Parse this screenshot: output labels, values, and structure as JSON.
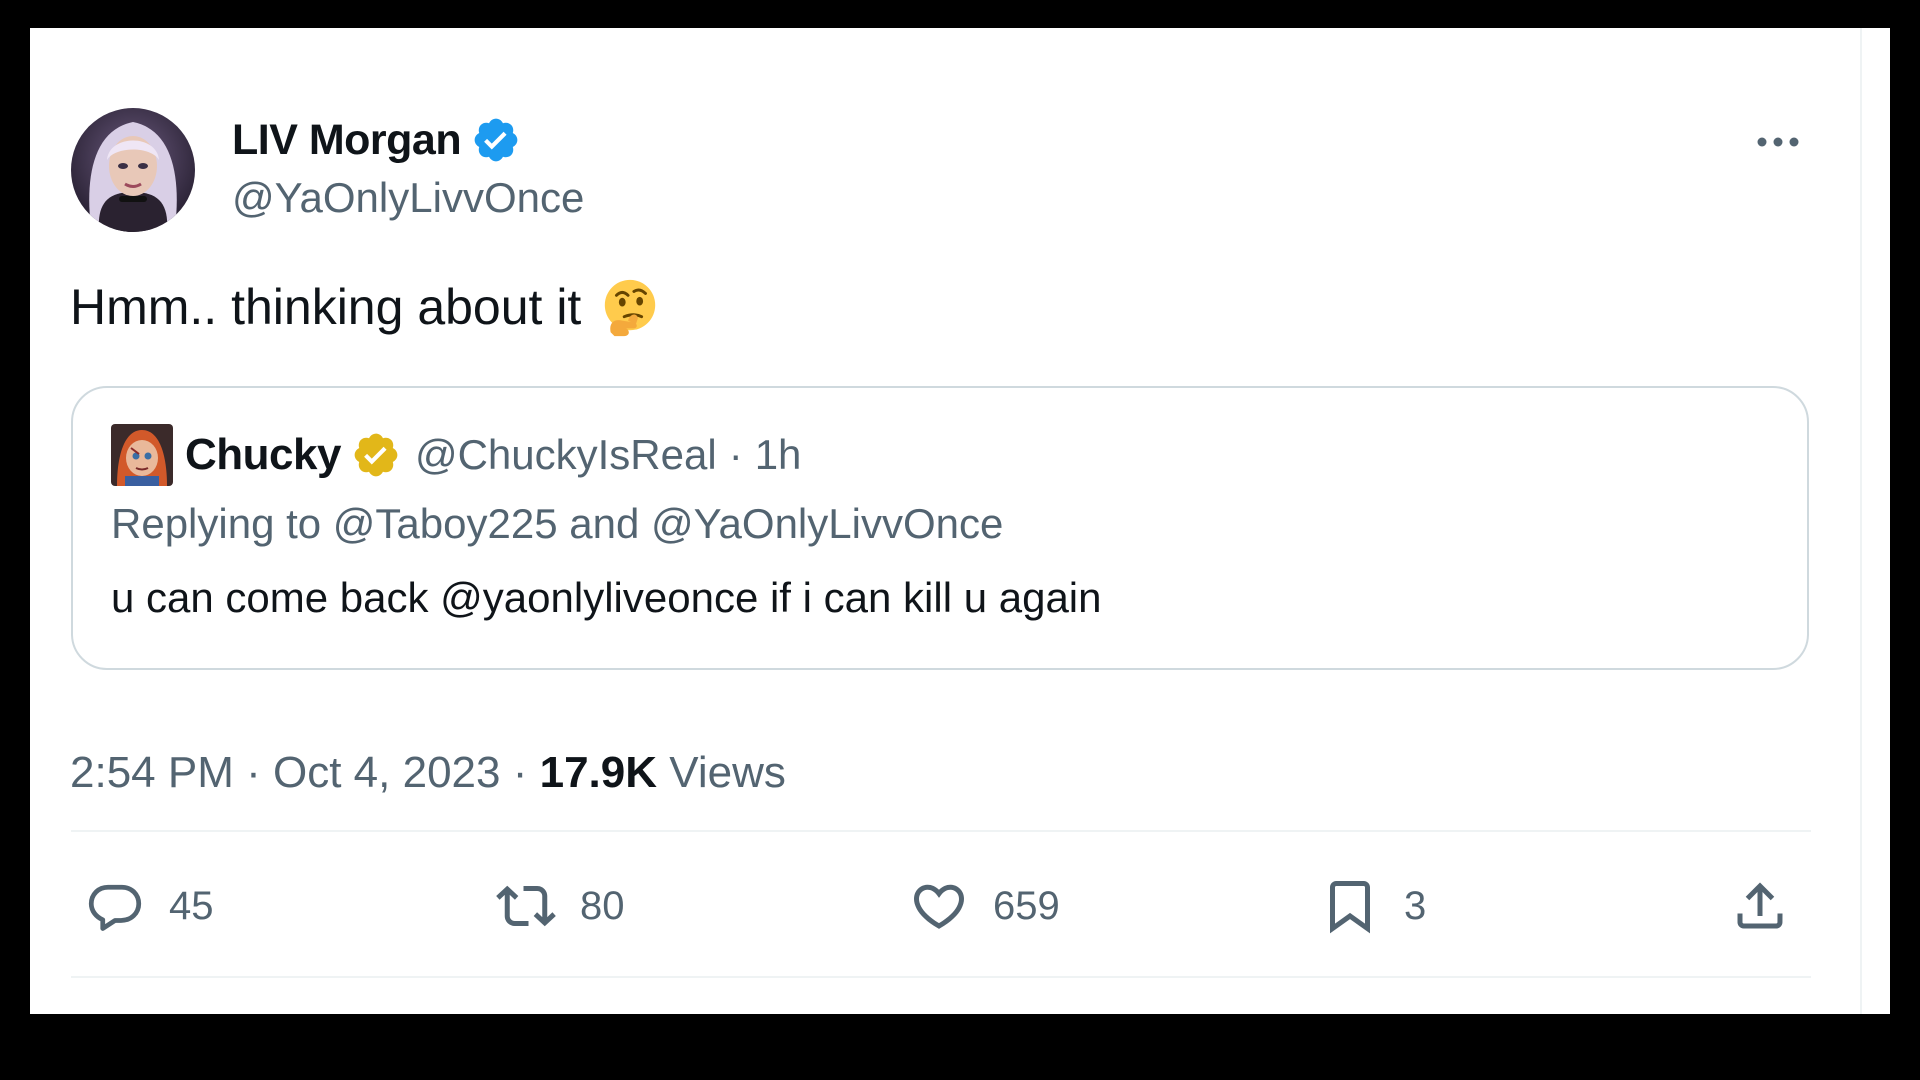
{
  "author": {
    "display_name": "LIV Morgan",
    "handle": "@YaOnlyLivvOnce",
    "verified_badge": "blue-verified-icon"
  },
  "tweet": {
    "text": "Hmm.. thinking about it",
    "emoji": "thinking-face-emoji"
  },
  "quote": {
    "display_name": "Chucky",
    "verified_badge": "gold-verified-icon",
    "handle": "@ChuckyIsReal",
    "separator": "·",
    "time": "1h",
    "replying_prefix": "Replying to",
    "replying_user_1": "@Taboy225",
    "replying_and": "and",
    "replying_user_2": "@YaOnlyLivvOnce",
    "text": "u can come back @yaonlyliveonce if i can kill u again"
  },
  "meta": {
    "time": "2:54 PM",
    "sep1": "·",
    "date": "Oct 4, 2023",
    "sep2": "·",
    "views_count": "17.9K",
    "views_label": "Views"
  },
  "actions": {
    "replies": "45",
    "reposts": "80",
    "likes": "659",
    "bookmarks": "3"
  },
  "colors": {
    "text_primary": "#0f1419",
    "text_secondary": "#536471",
    "verified_blue": "#1d9bf0",
    "verified_gold": "#e2b719",
    "border": "#cfd9de"
  }
}
